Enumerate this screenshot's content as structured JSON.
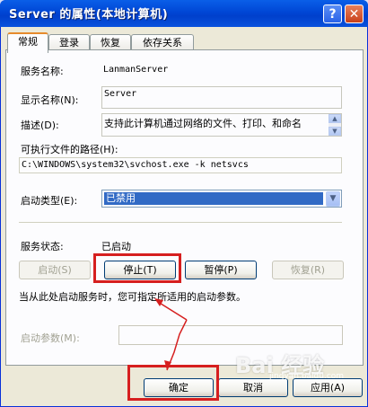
{
  "window": {
    "title": "Server 的属性(本地计算机)",
    "help_symbol": "?",
    "close_symbol": "✕"
  },
  "tabs": [
    {
      "label": "常规",
      "active": true
    },
    {
      "label": "登录",
      "active": false
    },
    {
      "label": "恢复",
      "active": false
    },
    {
      "label": "依存关系",
      "active": false
    }
  ],
  "general": {
    "service_name_label": "服务名称:",
    "service_name_value": "LanmanServer",
    "display_name_label": "显示名称(N):",
    "display_name_value": "Server",
    "description_label": "描述(D):",
    "description_value": "支持此计算机通过网络的文件、打印、和命名",
    "exe_path_label": "可执行文件的路径(H):",
    "exe_path_value": "C:\\WINDOWS\\system32\\svchost.exe -k netsvcs",
    "startup_type_label": "启动类型(E):",
    "startup_type_value": "已禁用",
    "status_label": "服务状态:",
    "status_value": "已启动",
    "btn_start": "启动(S)",
    "btn_stop": "停止(T)",
    "btn_pause": "暂停(P)",
    "btn_resume": "恢复(R)",
    "hint": "当从此处启动服务时，您可指定所适用的启动参数。",
    "params_label": "启动参数(M):",
    "params_value": ""
  },
  "footer": {
    "ok": "确定",
    "cancel": "取消",
    "apply": "应用(A)"
  },
  "watermark": {
    "logo": "Bai 经验",
    "url": "jingyan.baidu.com"
  },
  "colors": {
    "titlebar": "#0046d5",
    "highlight_box": "#d61f1f",
    "selection": "#316ac5"
  }
}
